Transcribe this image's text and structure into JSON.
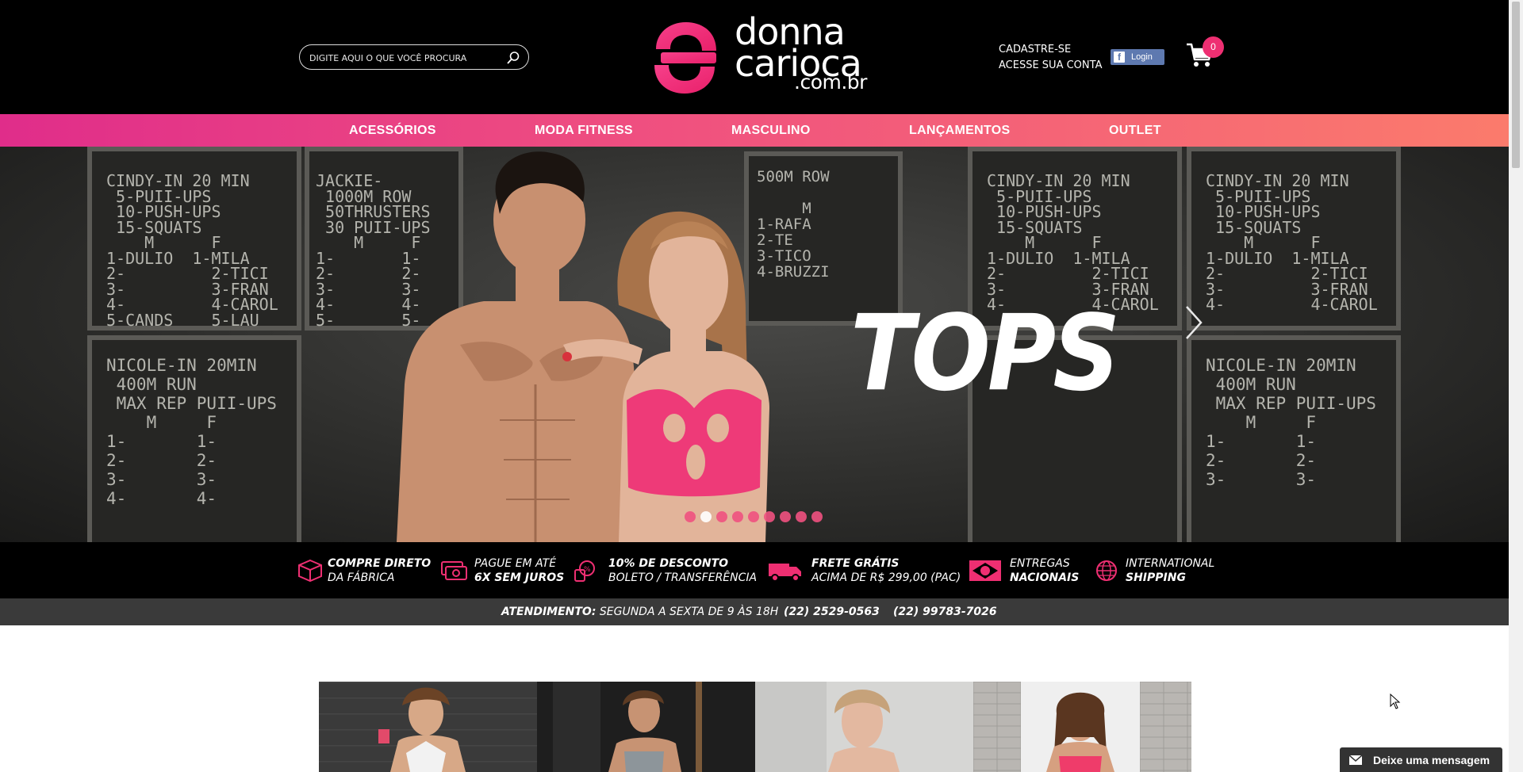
{
  "header": {
    "search": {
      "placeholder": "DIGITE AQUI O QUE VOCÊ PROCURA",
      "value": ""
    },
    "logo": {
      "line1": "donna",
      "line2": "carioca",
      "line3": ".com.br"
    },
    "account": {
      "register": "CADASTRE-SE",
      "login_account": "ACESSE SUA CONTA"
    },
    "facebook_login": "Login",
    "cart_count": "0"
  },
  "nav": {
    "items": [
      "ACESSÓRIOS",
      "MODA FITNESS",
      "MASCULINO",
      "LANÇAMENTOS",
      "OUTLET"
    ]
  },
  "hero": {
    "title": "TOPS",
    "slide_count": 9,
    "active_slide": 2,
    "chalkboard": {
      "b1": "CINDY-IN 20 MIN\n 5-PUII-UPS\n 10-PUSH-UPS\n 15-SQUATS\n    M      F\n1-DULIO  1-MILA\n2-         2-TICI\n3-         3-FRAN\n4-         4-CAROL\n5-CANDS    5-LAU",
      "b2": "JACKIE-\n 1000M ROW\n 50THRUSTERS\n 30 PUII-UPS\n    M     F\n1-       1-\n2-       2-\n3-       3-\n4-       4-\n5-       5-",
      "b3": "NICOLE-IN 20MIN\n 400M RUN\n MAX REP PUII-UPS\n    M     F\n1-       1-\n2-       2-\n3-       3-\n4-       4-",
      "b4": "500M ROW\n\n     M\n1-RAFA\n2-TE\n3-TICO\n4-BRUZZI",
      "b5": "CINDY-IN 20 MIN\n 5-PUII-UPS\n 10-PUSH-UPS\n 15-SQUATS\n    M      F\n1-DULIO  1-MILA\n2-         2-TICI\n3-         3-FRAN\n4-         4-CAROL",
      "b6": "NICOLE-IN 20MIN\n 400M RUN\n MAX REP PUII-UPS\n    M     F\n1-       1-\n2-       2-\n3-       3-"
    }
  },
  "features": [
    {
      "line1": "COMPRE DIRETO",
      "line2": "DA FÁBRICA",
      "icon": "box-icon"
    },
    {
      "line1": "PAGUE EM ATÉ",
      "line2": "6X SEM JUROS",
      "icon": "card-icon"
    },
    {
      "line1": "10% DE DESCONTO",
      "line2": "BOLETO / TRANSFERÊNCIA",
      "icon": "discount-icon"
    },
    {
      "line1": "FRETE GRÁTIS",
      "line2": "ACIMA DE R$ 299,00 (PAC)",
      "icon": "truck-icon"
    },
    {
      "line1": "ENTREGAS",
      "line2": "NACIONAIS",
      "icon": "brazil-flag-icon"
    },
    {
      "line1": "INTERNATIONAL",
      "line2": "SHIPPING",
      "icon": "globe-icon"
    }
  ],
  "hours": {
    "label": "ATENDIMENTO:",
    "text": "SEGUNDA A SEXTA DE 9 ÀS 18H",
    "phone1": "(22) 2529-0563",
    "phone2": "(22) 99783-7026"
  },
  "chat": {
    "label": "Deixe uma mensagem"
  },
  "colors": {
    "brand_pink": "#ee2f72",
    "nav_start": "#e02d8a",
    "nav_end": "#fb7b6c",
    "facebook": "#5e79b0"
  }
}
